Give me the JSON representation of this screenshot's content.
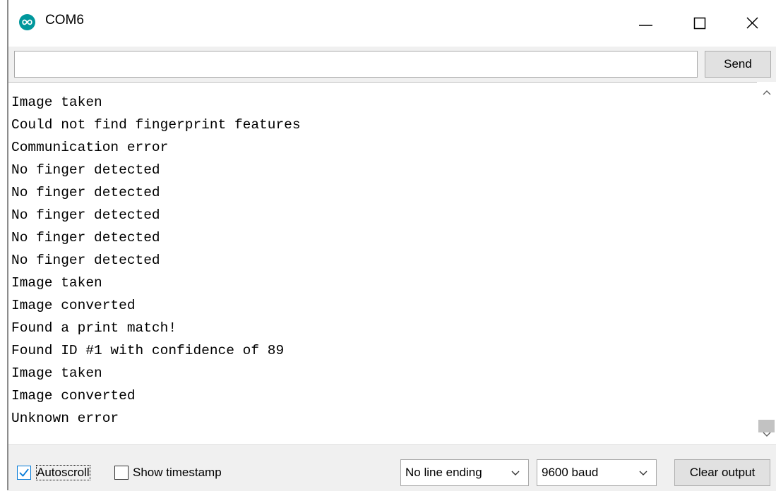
{
  "window": {
    "title": "COM6",
    "icon": "arduino-infinity-icon",
    "controls": [
      "minimize-icon",
      "maximize-icon",
      "close-icon"
    ]
  },
  "send_row": {
    "input_value": "",
    "send_label": "Send"
  },
  "output": {
    "lines": [
      "Image taken",
      "Could not find fingerprint features",
      "Communication error",
      "No finger detected",
      "No finger detected",
      "No finger detected",
      "No finger detected",
      "No finger detected",
      "Image taken",
      "Image converted",
      "Found a print match!",
      "Found ID #1 with confidence of 89",
      "Image taken",
      "Image converted",
      "Unknown error"
    ]
  },
  "bottom_bar": {
    "autoscroll": {
      "label": "Autoscroll",
      "checked": true
    },
    "show_timestamp": {
      "label": "Show timestamp",
      "checked": false
    },
    "line_ending": "No line ending",
    "baud_rate": "9600 baud",
    "clear_label": "Clear output"
  },
  "colors": {
    "arduino_teal": "#00979c",
    "checkbox_accent": "#0078d7",
    "bar_background": "#f0f0f0"
  }
}
